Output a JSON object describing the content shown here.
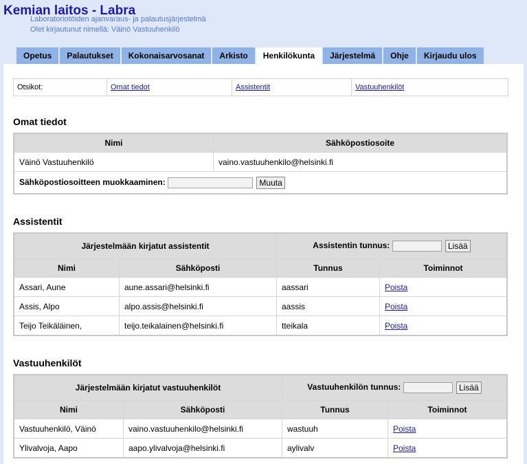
{
  "header": {
    "title": "Kemian laitos - Labra",
    "subtitle": "Laboratoriotöiden ajanvaraus- ja palautusjärjestelmä",
    "login_status": "Olet kirjautunut nimellä: Väinö Vastuuhenkilö"
  },
  "tabs": [
    {
      "label": "Opetus"
    },
    {
      "label": "Palautukset"
    },
    {
      "label": "Kokonaisarvosanat"
    },
    {
      "label": "Arkisto"
    },
    {
      "label": "Henkilökunta",
      "active": true
    },
    {
      "label": "Järjestelmä"
    },
    {
      "label": "Ohje"
    },
    {
      "label": "Kirjaudu ulos"
    }
  ],
  "subnav": {
    "label": "Otsikot:",
    "links": [
      "Omat tiedot",
      "Assistentit",
      "Vastuuhenkilöt"
    ]
  },
  "own": {
    "heading": "Omat tiedot",
    "col_name": "Nimi",
    "col_email": "Sähköpostiosoite",
    "name": "Väinö Vastuuhenkilö",
    "email": "vaino.vastuuhenkilo@helsinki.fi",
    "edit_label": "Sähköpostiosoitteen muokkaaminen:",
    "edit_value": "",
    "edit_button": "Muuta"
  },
  "assistants": {
    "heading": "Assistentit",
    "bar_title": "Järjestelmään kirjatut assistentit",
    "id_label": "Assistentin tunnus:",
    "id_value": "",
    "add_button": "Lisää",
    "columns": [
      "Nimi",
      "Sähköposti",
      "Tunnus",
      "Toiminnot"
    ],
    "rows": [
      {
        "name": "Assari, Aune",
        "email": "aune.assari@helsinki.fi",
        "id": "aassari",
        "action": "Poista"
      },
      {
        "name": "Assis, Alpo",
        "email": "alpo.assis@helsinki.fi",
        "id": "aassis",
        "action": "Poista"
      },
      {
        "name": "Teijo Teikäläinen,",
        "email": "teijo.teikalainen@helsinki.fi",
        "id": "tteikala",
        "action": "Poista"
      }
    ]
  },
  "responsibles": {
    "heading": "Vastuuhenkilöt",
    "bar_title": "Järjestelmään kirjatut vastuuhenkilöt",
    "id_label": "Vastuuhenkilön tunnus:",
    "id_value": "",
    "add_button": "Lisää",
    "columns": [
      "Nimi",
      "Sähköposti",
      "Tunnus",
      "Toiminnot"
    ],
    "rows": [
      {
        "name": "Vastuuhenkilö, Väinö",
        "email": "vaino.vastuuhenkilo@helsinki.fi",
        "id": "wastuuh",
        "action": "Poista"
      },
      {
        "name": "Ylivalvoja, Aapo",
        "email": "aapo.ylivalvoja@helsinki.fi",
        "id": "aylivalv",
        "action": "Poista"
      }
    ]
  }
}
